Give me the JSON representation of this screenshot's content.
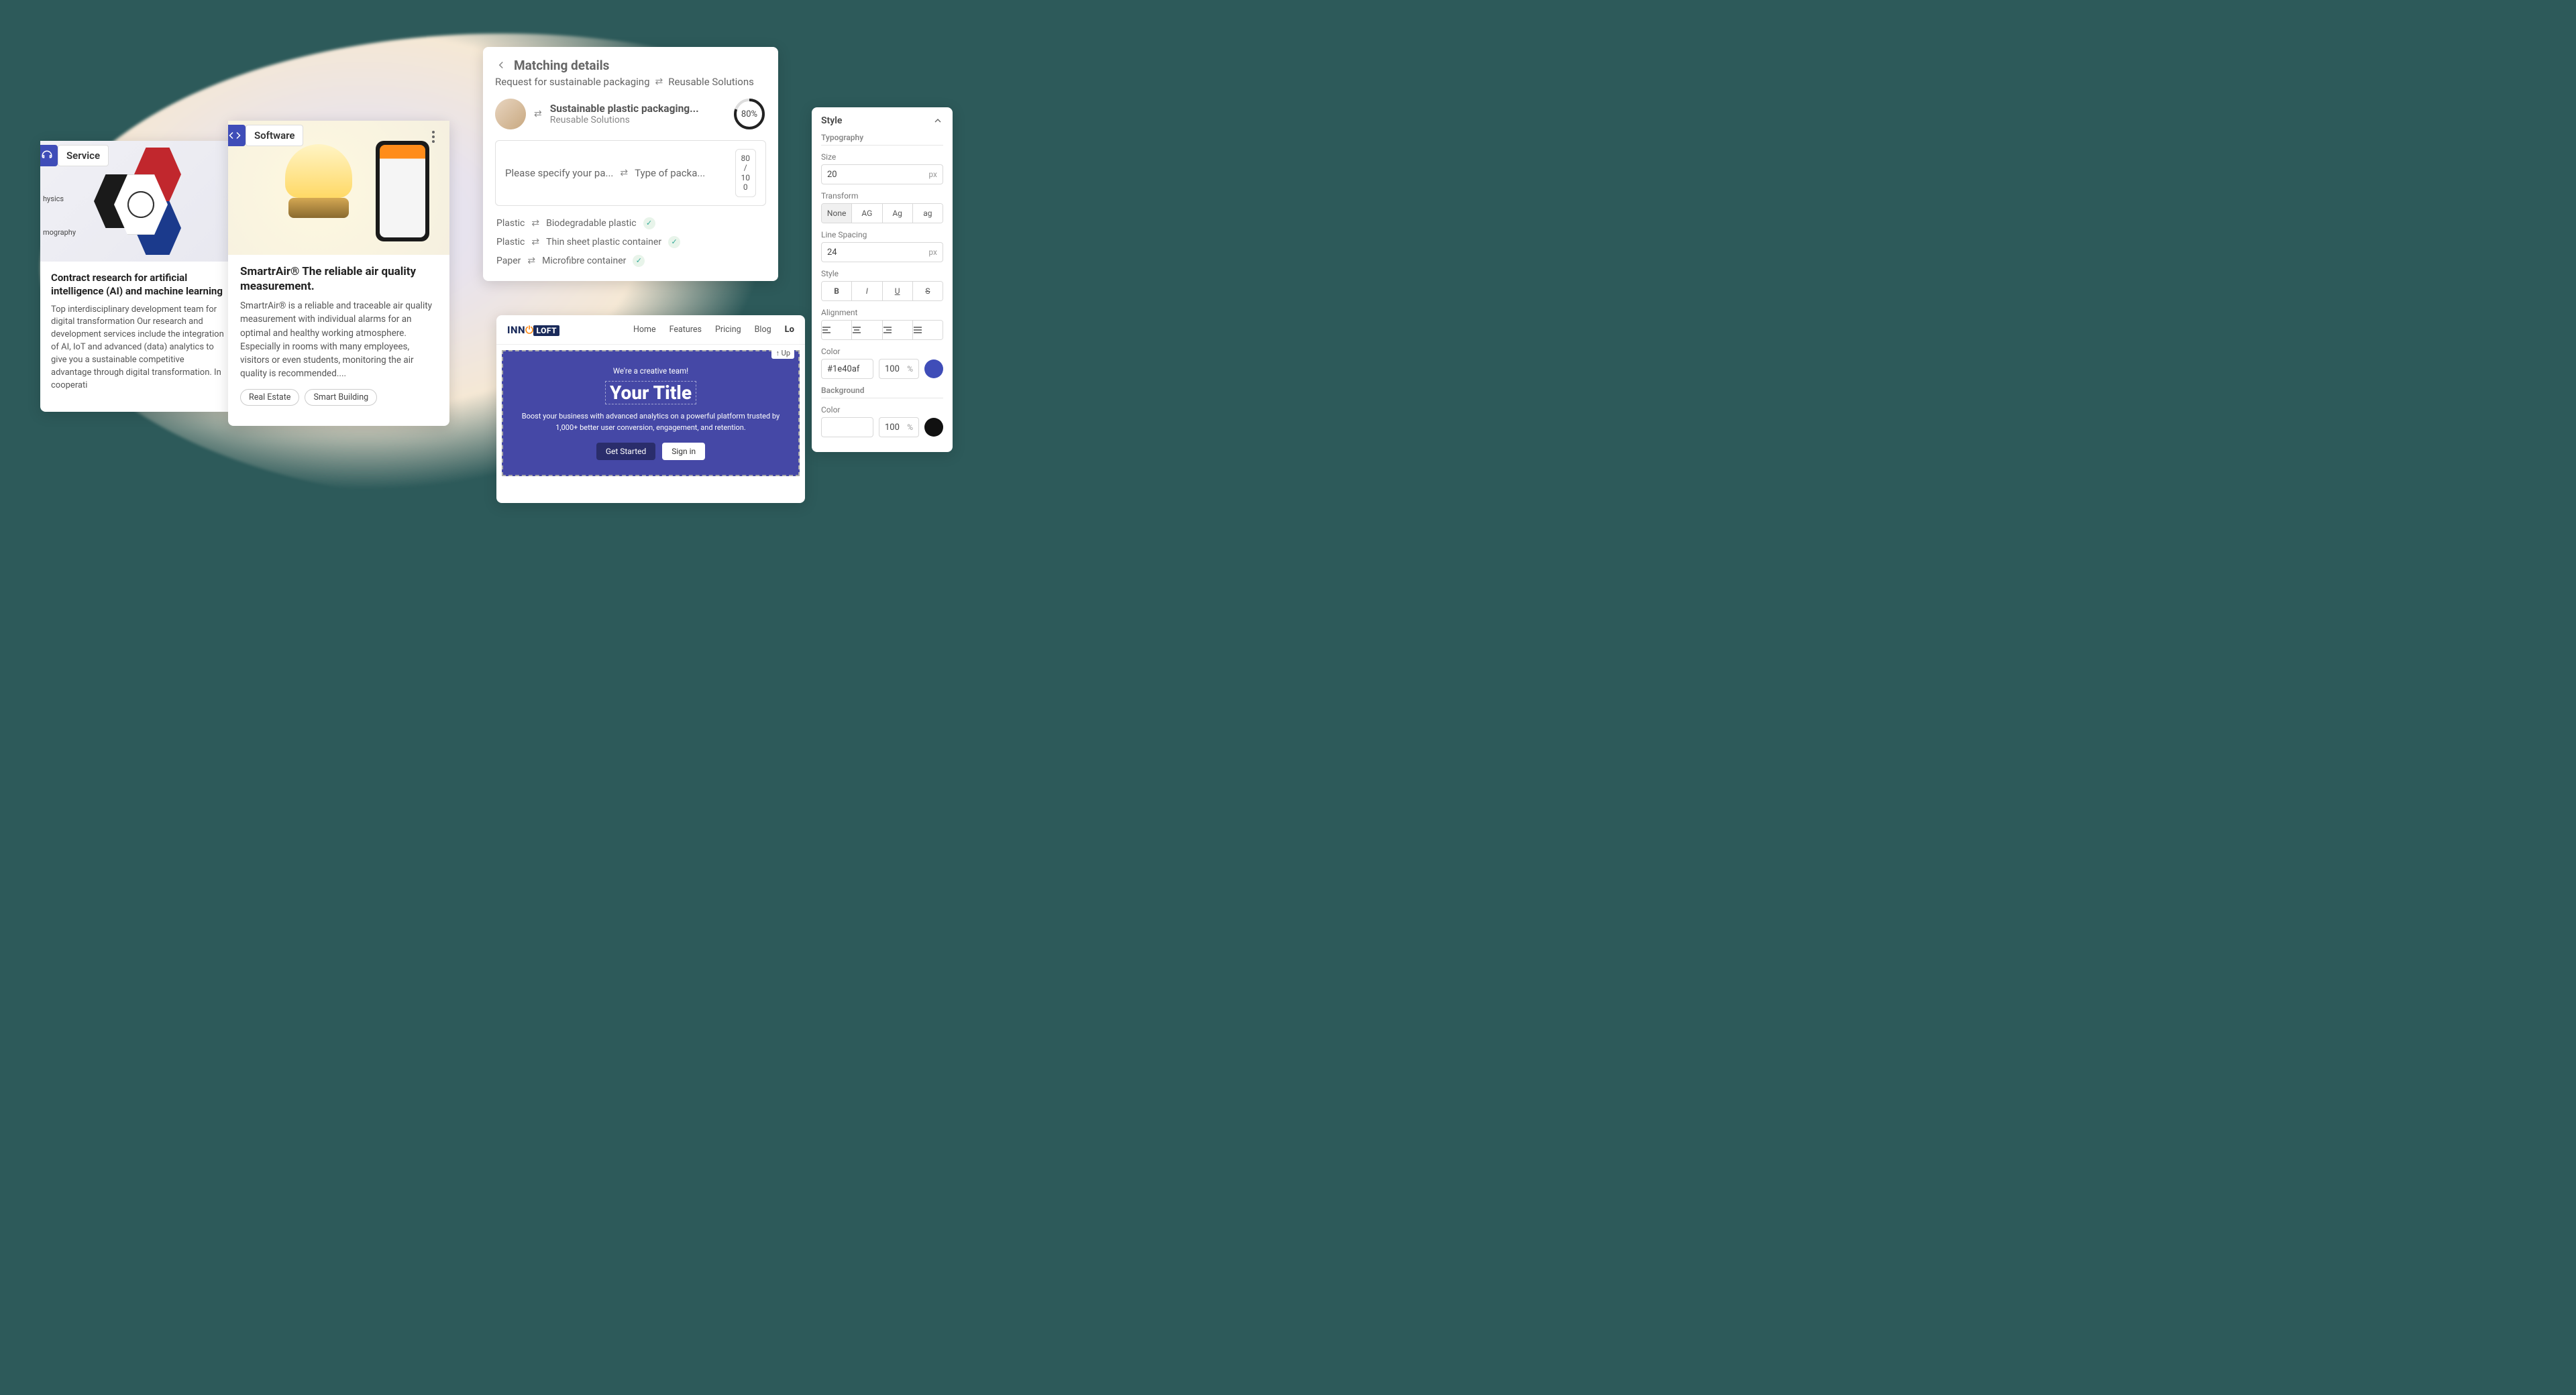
{
  "card1": {
    "tag": "Service",
    "side1": "hysics",
    "side2": "mography",
    "title": "Contract research for artificial intelligence (AI) and machine learning",
    "desc": "Top interdisciplinary development team for digital transformation Our research and development services include the integration of AI, IoT and advanced (data) analytics to give you a sustainable competitive advantage through digital transformation. In cooperati"
  },
  "card2": {
    "tag": "Software",
    "title": "SmartrAir® The reliable air quality measurement.",
    "desc": "SmartrAir® is a reliable and traceable air quality measurement with individual alarms for an optimal and healthy working atmosphere. Especially in rooms with many employees, visitors or even students, monitoring the air quality is recommended....",
    "chip1": "Real Estate",
    "chip2": "Smart Building"
  },
  "match": {
    "title": "Matching details",
    "request": "Request for sustainable packaging",
    "solution": "Reusable Solutions",
    "itemTitle": "Sustainable plastic packaging...",
    "itemSub": "Reusable Solutions",
    "percent": "80%",
    "q1": "Please specify your pa...",
    "q2": "Type of packa...",
    "score1": "80",
    "scoreSlash": "/",
    "score2": "10",
    "score3": "0",
    "lines": [
      {
        "a": "Plastic",
        "b": "Biodegradable plastic"
      },
      {
        "a": "Plastic",
        "b": "Thin sheet plastic container"
      },
      {
        "a": "Paper",
        "b": "Microfibre container"
      }
    ]
  },
  "builder": {
    "logo1": "INN",
    "logo2": "LOFT",
    "nav": [
      "Home",
      "Features",
      "Pricing",
      "Blog"
    ],
    "lo": "Lo",
    "up": "↑ Up",
    "pre": "We're a creative team!",
    "title": "Your Title",
    "desc": "Boost your business with advanced analytics on a powerful platform trusted by 1,000+ better user conversion, engagement, and retention.",
    "btn1": "Get Started",
    "btn2": "Sign in"
  },
  "style": {
    "title": "Style",
    "typo": "Typography",
    "sizeLabel": "Size",
    "sizeVal": "20",
    "px": "px",
    "transformLabel": "Transform",
    "transforms": [
      "None",
      "AG",
      "Ag",
      "ag"
    ],
    "lineLabel": "Line Spacing",
    "lineVal": "24",
    "styleLabel": "Style",
    "styles": [
      "B",
      "I",
      "U",
      "S"
    ],
    "alignLabel": "Alignment",
    "colorLabel": "Color",
    "colorVal": "#1e40af",
    "opacity": "100",
    "pct": "%",
    "bgLabel": "Background",
    "bgColorLabel": "Color",
    "bgOpacity": "100"
  }
}
